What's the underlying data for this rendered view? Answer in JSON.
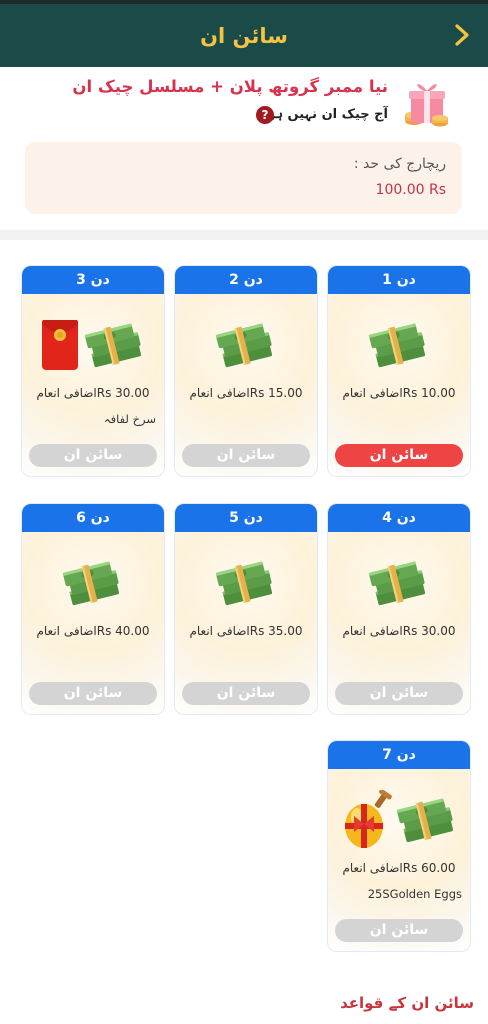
{
  "header": {
    "title": "سائن ان",
    "back_icon": "chevron-right-icon"
  },
  "promo": {
    "headline": "نیا ممبر گروتھ پلان + مسلسل چیک ان",
    "status": "آج چیک ان نہیں ہوا",
    "help_glyph": "?",
    "gift_icon": "gift-box-icon"
  },
  "recharge": {
    "label": "ریچارج کی حد  :",
    "value": "100.00 Rs"
  },
  "days": [
    {
      "day": "دن 1",
      "reward": "اضافی انعامRs 10.00",
      "extra": "",
      "button": "سائن ان",
      "active": true,
      "icons": [
        "cash-icon"
      ]
    },
    {
      "day": "دن 2",
      "reward": "اضافی انعامRs 15.00",
      "extra": "",
      "button": "سائن ان",
      "active": false,
      "icons": [
        "cash-icon"
      ]
    },
    {
      "day": "دن 3",
      "reward": "اضافی انعامRs 30.00",
      "extra": "سرخ لفافہ",
      "button": "سائن ان",
      "active": false,
      "icons": [
        "red-envelope-icon",
        "cash-icon"
      ]
    },
    {
      "day": "دن 4",
      "reward": "اضافی انعامRs 30.00",
      "extra": "",
      "button": "سائن ان",
      "active": false,
      "icons": [
        "cash-icon"
      ]
    },
    {
      "day": "دن 5",
      "reward": "اضافی انعامRs 35.00",
      "extra": "",
      "button": "سائن ان",
      "active": false,
      "icons": [
        "cash-icon"
      ]
    },
    {
      "day": "دن 6",
      "reward": "اضافی انعامRs 40.00",
      "extra": "",
      "button": "سائن ان",
      "active": false,
      "icons": [
        "cash-icon"
      ]
    },
    {
      "day": "دن 7",
      "reward": "اضافی انعامRs 60.00",
      "extra": "25SGolden Eggs",
      "button": "سائن ان",
      "active": false,
      "icons": [
        "golden-egg-icon",
        "cash-icon"
      ]
    }
  ],
  "rules_link": "سائن ان کے قواعد",
  "colors": {
    "header": "#1b4b48",
    "title": "#f5c242",
    "accent": "#d8324d",
    "day_tab": "#1a73e8",
    "active_button": "#ef4444",
    "disabled_button": "#d4d4d4"
  }
}
